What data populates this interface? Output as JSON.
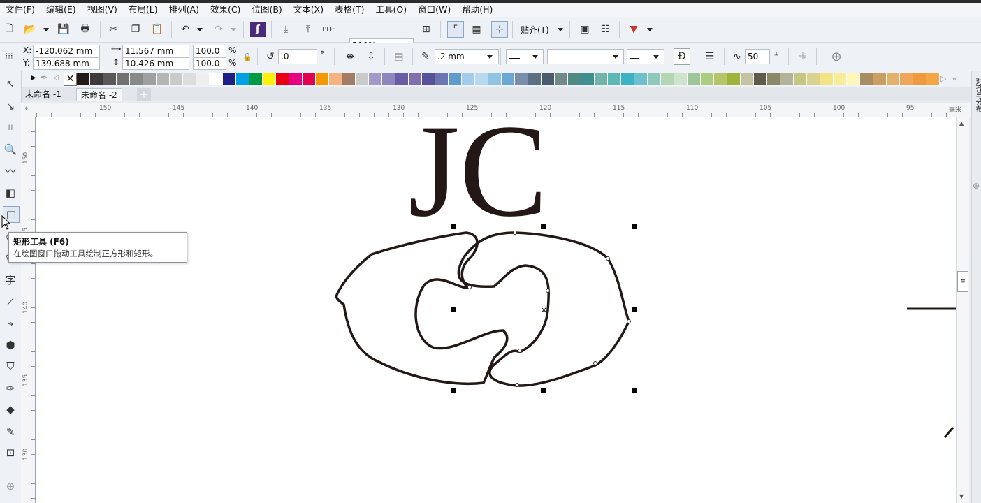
{
  "menubar": [
    "文件(F)",
    "编辑(E)",
    "视图(V)",
    "布局(L)",
    "排列(A)",
    "效果(C)",
    "位图(B)",
    "文本(X)",
    "表格(T)",
    "工具(O)",
    "窗口(W)",
    "帮助(H)"
  ],
  "toolbar": {
    "zoom": "500%",
    "snap_label": "贴齐(T)"
  },
  "property_bar": {
    "x_label": "X:",
    "x_value": "-120.062 mm",
    "y_label": "Y:",
    "y_value": "139.688 mm",
    "width_value": "11.567 mm",
    "height_value": "10.426 mm",
    "scale_x": "100.0",
    "scale_y": "100.0",
    "percent": "%",
    "rotation": ".0",
    "degree": "°",
    "outline_width": ".2 mm",
    "smoothing": "50"
  },
  "palette": [
    "#231815",
    "#3e3a39",
    "#595757",
    "#727171",
    "#898989",
    "#9fa0a0",
    "#b5b5b6",
    "#c9caca",
    "#dcdddd",
    "#efefef",
    "#ffffff",
    "#1d2088",
    "#00a0e9",
    "#009944",
    "#fff100",
    "#e60012",
    "#e4007f",
    "#e5004f",
    "#f39800",
    "#f6b37f",
    "#a27c63",
    "#c9caca",
    "#a29bc9",
    "#8c87be",
    "#6a5ba5",
    "#7f6fae",
    "#56539b",
    "#6c76b4",
    "#5e9ccc",
    "#a3cbec",
    "#b9d9ee",
    "#8fc4e5",
    "#6aa7d5",
    "#7a8eac",
    "#5b6f85",
    "#4c5b6c",
    "#708a8a",
    "#4f8a83",
    "#3e8f8e",
    "#6fb5a8",
    "#5bb8b4",
    "#3cb2c6",
    "#6dc0ce",
    "#8fc9bb",
    "#b5d6b3",
    "#cfe3cd",
    "#9fc59b",
    "#adcd7e",
    "#b6c46a",
    "#9db43b",
    "#c3c3a3",
    "#5f5b4b",
    "#8a8a6a",
    "#b3b39a",
    "#c7c785",
    "#d9d38e",
    "#f2e384",
    "#f8ed9c",
    "#fff6b8",
    "#a98d60",
    "#c9a063",
    "#e3b16a",
    "#f0a65a",
    "#f09a40",
    "#f4a646"
  ],
  "doc_tabs": [
    "未命名 -1",
    "未命名 -2"
  ],
  "ruler": {
    "h_labels": [
      "150",
      "145",
      "140",
      "135",
      "130",
      "125",
      "120",
      "115",
      "110",
      "105",
      "100",
      "95",
      "毫米"
    ],
    "v_labels": [
      "150",
      "145",
      "140",
      "135",
      "130"
    ]
  },
  "canvas": {
    "text": "JC"
  },
  "docker": {
    "title": "对齐与分布"
  },
  "tooltip": {
    "title": "矩形工具 (F6)",
    "desc": "在绘图窗口拖动工具绘制正方形和矩形。"
  }
}
